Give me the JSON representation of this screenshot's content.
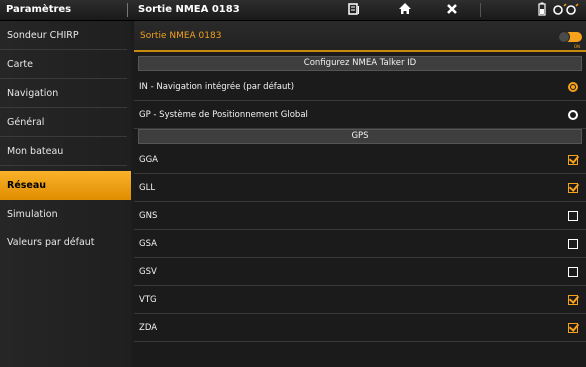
{
  "topbar": {
    "left_title": "Paramètres",
    "page_title": "Sortie NMEA  0183",
    "icons": [
      "screen-icon",
      "home-icon",
      "close-icon",
      "battery-icon",
      "settings-icon"
    ]
  },
  "sidebar": {
    "items": [
      {
        "label": "Sondeur CHIRP"
      },
      {
        "label": "Carte"
      },
      {
        "label": "Navigation"
      },
      {
        "label": "Général"
      },
      {
        "label": "Mon bateau"
      },
      {
        "label": "Réseau",
        "active": true
      },
      {
        "label": "Simulation"
      },
      {
        "label": "Valeurs par défaut"
      }
    ]
  },
  "main": {
    "header_label": "Sortie NMEA  0183",
    "toggle_state": "ON",
    "talker_section": "Configurez NMEA Talker ID",
    "talker_options": [
      {
        "label": "IN - Navigation intégrée (par défaut)",
        "selected": true
      },
      {
        "label": "GP - Système de Positionnement Global",
        "selected": false
      }
    ],
    "gps_section": "GPS",
    "gps_sentences": [
      {
        "label": "GGA",
        "checked": true
      },
      {
        "label": "GLL",
        "checked": true
      },
      {
        "label": "GNS",
        "checked": false
      },
      {
        "label": "GSA",
        "checked": false
      },
      {
        "label": "GSV",
        "checked": false
      },
      {
        "label": "VTG",
        "checked": true
      },
      {
        "label": "ZDA",
        "checked": true
      }
    ]
  },
  "colors": {
    "accent": "#f6a21b",
    "background": "#1b1b1b"
  }
}
